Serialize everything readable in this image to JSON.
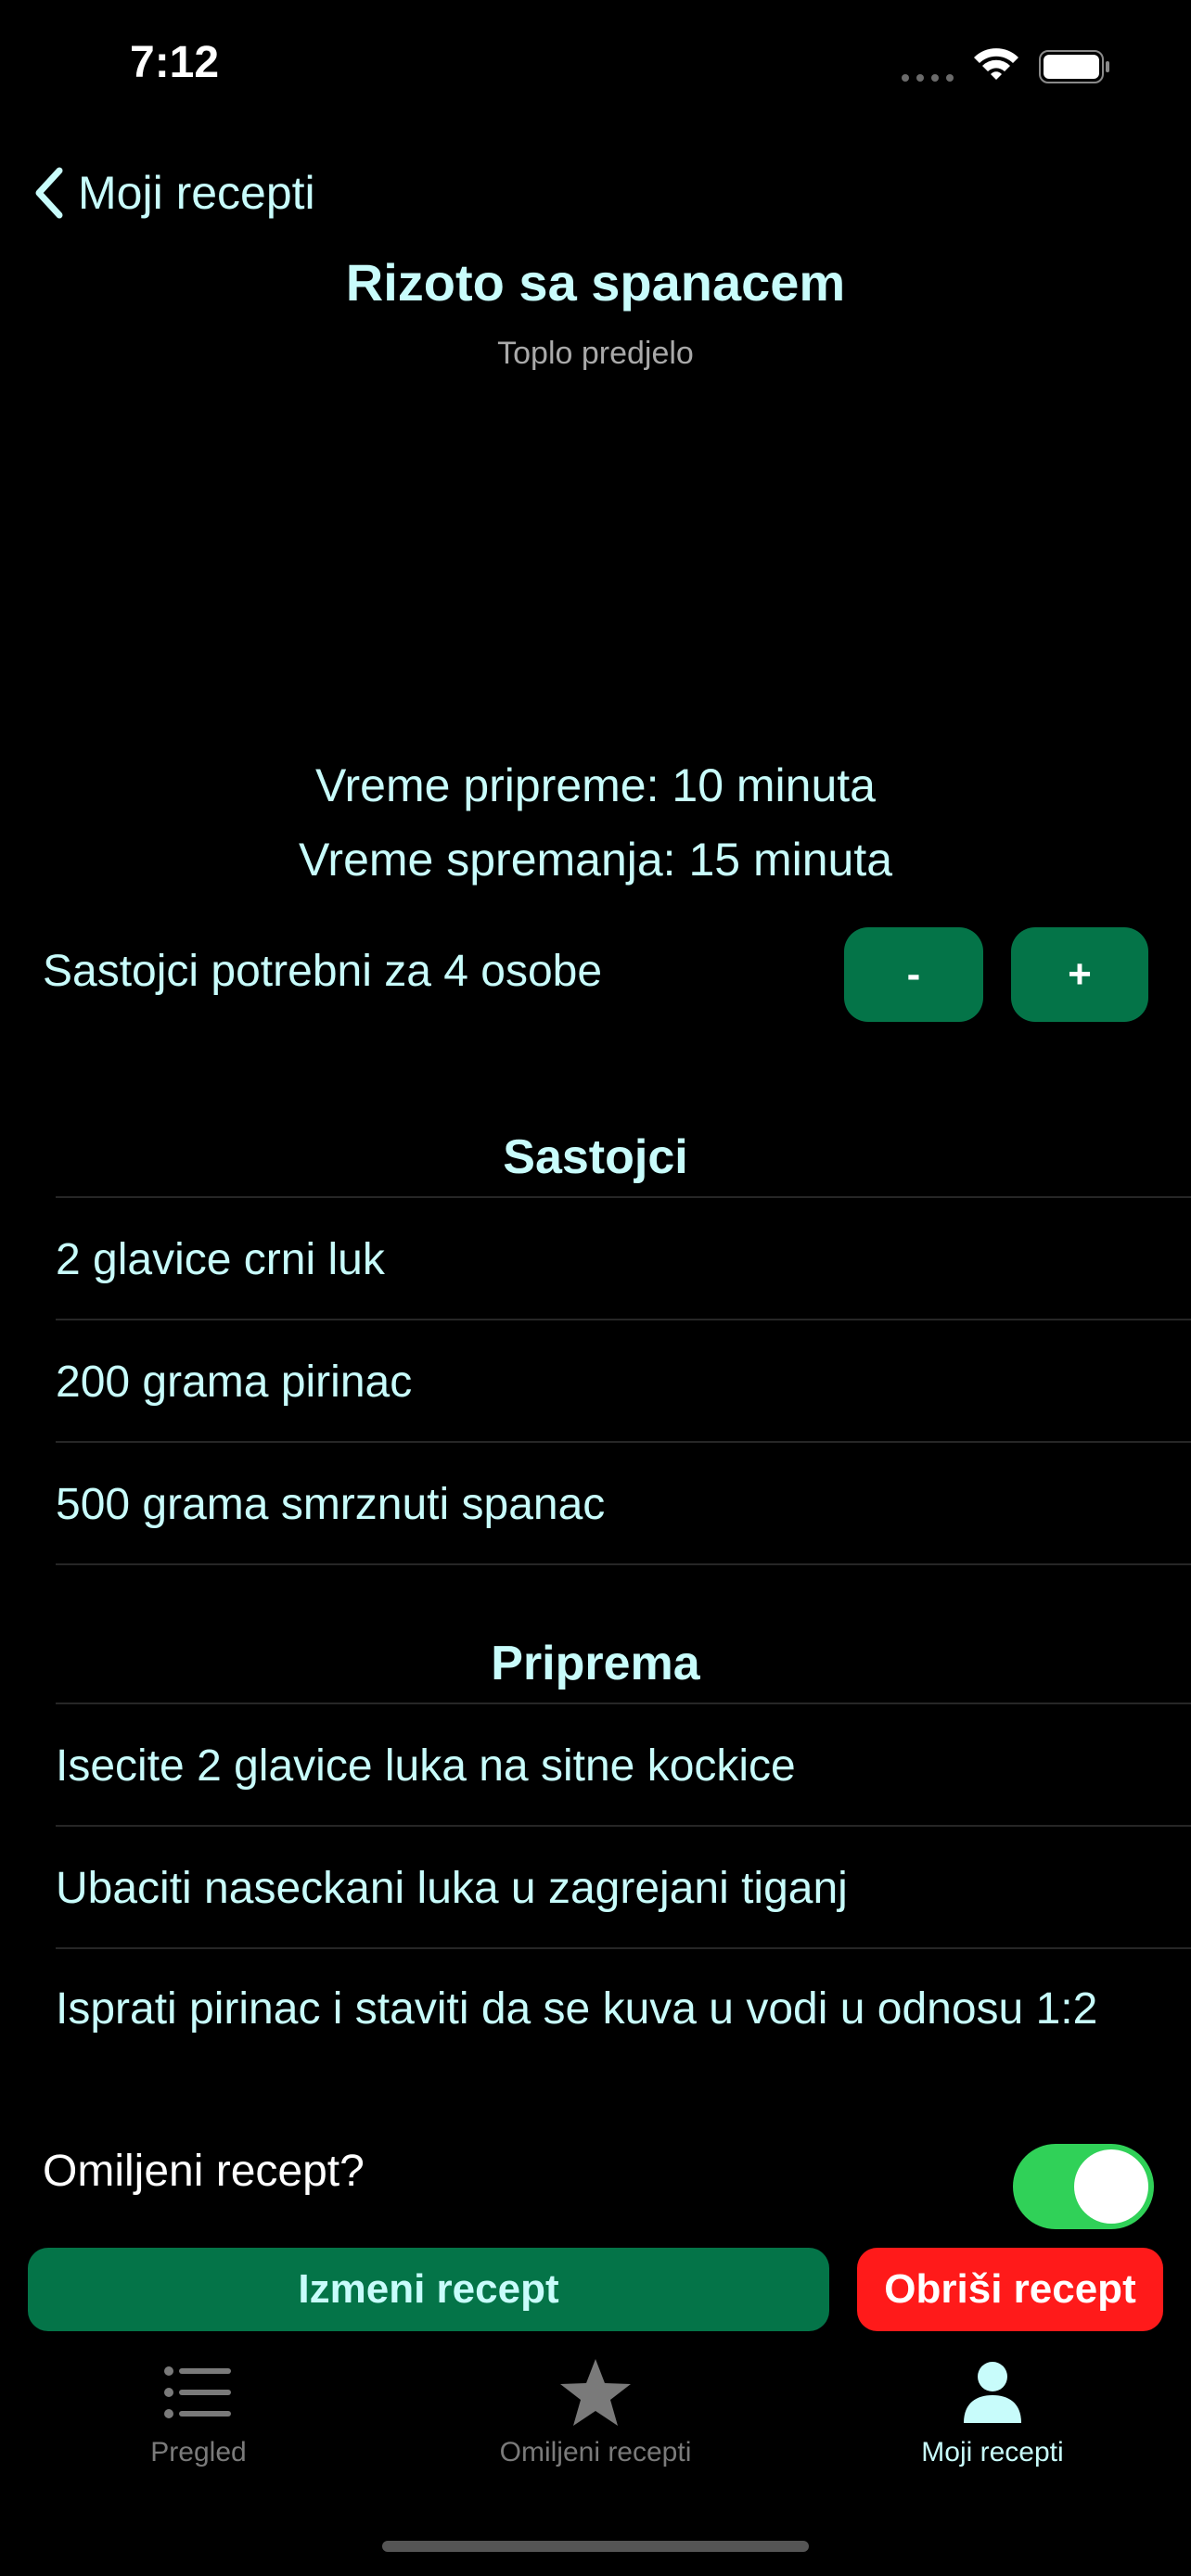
{
  "status_bar": {
    "time": "7:12"
  },
  "nav": {
    "back_label": "Moji recepti"
  },
  "recipe": {
    "title": "Rizoto sa spanacem",
    "category": "Toplo predjelo",
    "prep_time": "Vreme pripreme: 10 minuta",
    "cook_time": "Vreme spremanja: 15 minuta",
    "servings_text": "Sastojci potrebni za 4 osobe",
    "minus_label": "-",
    "plus_label": "+"
  },
  "ingredients": {
    "title": "Sastojci",
    "items": [
      "2 glavice crni luk",
      "200 grama pirinac",
      "500 grama smrznuti spanac"
    ]
  },
  "preparation": {
    "title": "Priprema",
    "steps": [
      "Isecite 2 glavice luka na sitne kockice",
      "Ubaciti naseckani luka u zagrejani tiganj",
      "Isprati pirinac i staviti da se kuva u vodi u odnosu 1:2"
    ]
  },
  "favorite": {
    "label": "Omiljeni recept?",
    "on": true
  },
  "actions": {
    "edit_label": "Izmeni recept",
    "delete_label": "Obriši recept"
  },
  "tab_bar": {
    "tabs": [
      {
        "label": "Pregled",
        "icon": "list-icon",
        "active": false
      },
      {
        "label": "Omiljeni recepti",
        "icon": "star-icon",
        "active": false
      },
      {
        "label": "Moji recepti",
        "icon": "person-icon",
        "active": true
      }
    ]
  },
  "colors": {
    "accent_text": "#c8fcfb",
    "green": "#047448",
    "red": "#ff1a1a",
    "toggle_on": "#30d158",
    "inactive_tab": "#7a7a7a"
  }
}
